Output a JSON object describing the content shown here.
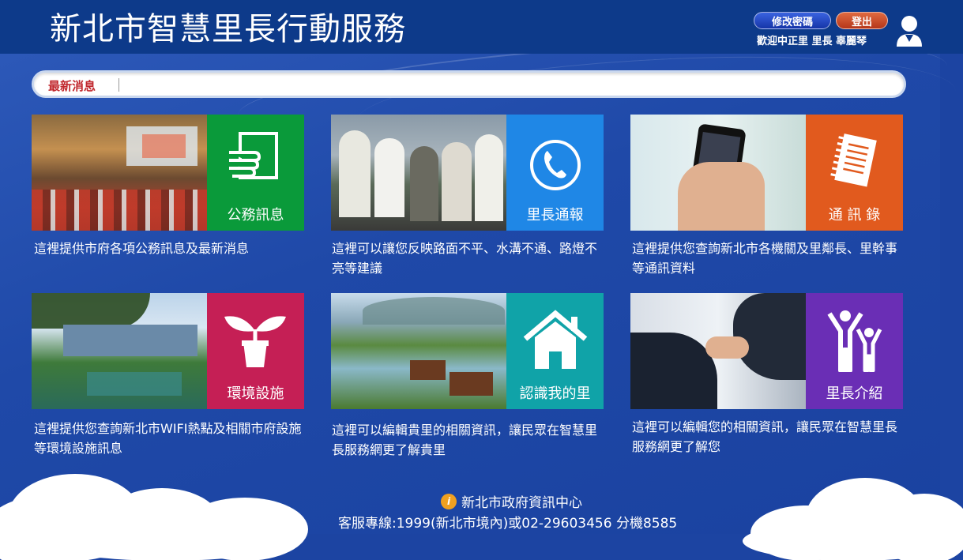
{
  "header": {
    "title": "新北市智慧里長行動服務",
    "change_password": "修改密碼",
    "logout": "登出",
    "welcome": "歡迎中正里 里長 辜麗琴"
  },
  "news": {
    "label": "最新消息"
  },
  "tiles": [
    {
      "label": "公務訊息",
      "icon": "handshake-doc-icon",
      "color": "#0a9a3a",
      "desc": "這裡提供市府各項公務訊息及最新消息"
    },
    {
      "label": "里長通報",
      "icon": "phone-icon",
      "color": "#1f87e6",
      "desc": "這裡可以讓您反映路面不平、水溝不通、路燈不亮等建議"
    },
    {
      "label": "通 訊 錄",
      "icon": "notepad-icon",
      "color": "#e15a1e",
      "desc": "這裡提供您查詢新北市各機關及里鄰長、里幹事等通訊資料"
    },
    {
      "label": "環境設施",
      "icon": "plant-icon",
      "color": "#c51f55",
      "desc": "這裡提供您查詢新北市WIFI熱點及相關市府設施等環境設施訊息"
    },
    {
      "label": "認識我的里",
      "icon": "house-icon",
      "color": "#10a3a8",
      "desc": "這裡可以編輯貴里的相關資訊，讓民眾在智慧里長服務網更了解貴里"
    },
    {
      "label": "里長介紹",
      "icon": "people-icon",
      "color": "#6a2eb5",
      "desc": "這裡可以編輯您的相關資訊，讓民眾在智慧里長服務網更了解您"
    }
  ],
  "footer": {
    "org": "新北市政府資訊中心",
    "hotline": "客服專線:1999(新北市境內)或02-29603456 分機8585"
  }
}
